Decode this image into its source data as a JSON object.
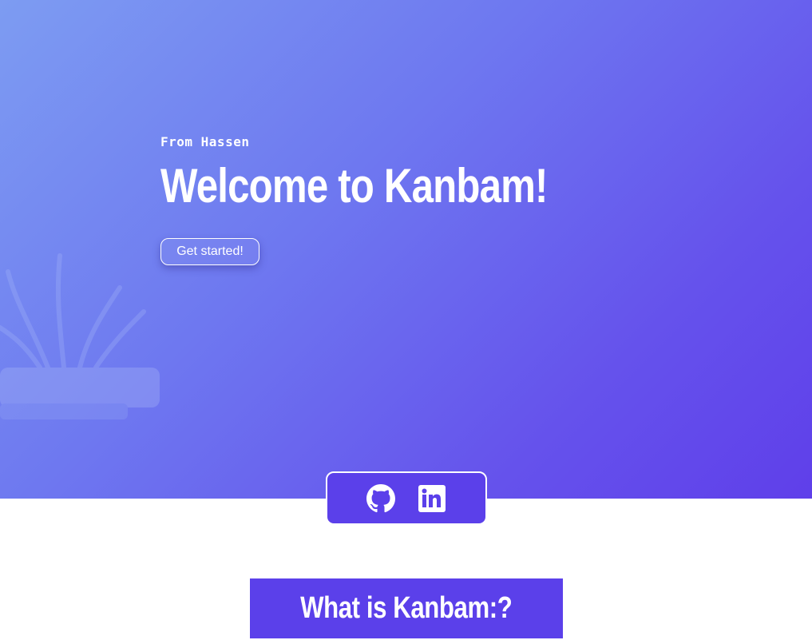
{
  "hero": {
    "eyebrow": "From Hassen",
    "title": "Welcome to Kanbam!",
    "cta_label": "Get started!"
  },
  "social": {
    "links": [
      {
        "name": "GitHub",
        "icon": "github-icon"
      },
      {
        "name": "LinkedIn",
        "icon": "linkedin-icon"
      }
    ]
  },
  "section": {
    "heading": "What is Kanbam:?"
  },
  "colors": {
    "accent": "#5b40ea",
    "gradient_start": "#7d9cf2",
    "gradient_end": "#5f3fea"
  }
}
